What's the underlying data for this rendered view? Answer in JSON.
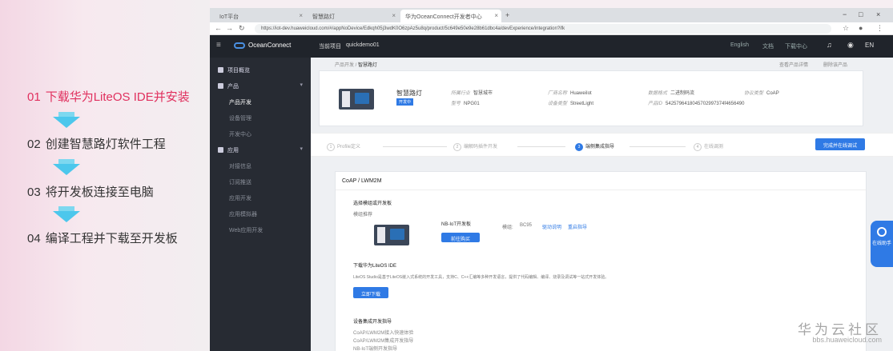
{
  "slide": {
    "steps": [
      {
        "num": "01",
        "text": "下载华为LiteOS IDE并安装",
        "active": true
      },
      {
        "num": "02",
        "text": "创建智慧路灯软件工程",
        "active": false
      },
      {
        "num": "03",
        "text": "将开发板连接至电脑",
        "active": false
      },
      {
        "num": "04",
        "text": "编译工程并下载至开发板",
        "active": false
      }
    ]
  },
  "browser": {
    "tabs": [
      "IoT平台",
      "智慧路灯",
      "华为OceanConnect开发者中心"
    ],
    "new_tab": "+",
    "url": "https://iot-dev.huaweicloud.com/#/appNoDevice/Edkqh05j3wdK0O6zpAz5u8q/product/5c649e50e9e28b61dbc4a/devExperience/integration?ifk",
    "win_controls": [
      "−",
      "□",
      "×"
    ]
  },
  "topnav": {
    "brand": "OceanConnect",
    "project_label": "当前项目",
    "project_value": "quickdemo01",
    "right": [
      "English",
      "文档",
      "下载中心",
      "EN"
    ]
  },
  "sidebar": {
    "items": [
      {
        "label": "项目概览",
        "type": "grp"
      },
      {
        "label": "产品",
        "type": "grp",
        "caret": "▾"
      },
      {
        "label": "产品开发",
        "type": "sub",
        "selected": true
      },
      {
        "label": "设备管理",
        "type": "sub"
      },
      {
        "label": "开发中心",
        "type": "sub"
      },
      {
        "label": "应用",
        "type": "grp",
        "caret": "▾"
      },
      {
        "label": "对接信息",
        "type": "sub"
      },
      {
        "label": "订阅推送",
        "type": "sub"
      },
      {
        "label": "应用开发",
        "type": "sub"
      },
      {
        "label": "应用模拟器",
        "type": "sub"
      },
      {
        "label": "Web应用开发",
        "type": "sub"
      }
    ]
  },
  "content": {
    "breadcrumb": [
      "产品开发",
      "智慧路灯"
    ],
    "top_links": [
      "查看产品详情",
      "删除该产品"
    ],
    "product": {
      "name": "智慧路灯",
      "badge": "开发中",
      "fields": [
        {
          "k": "所属行业",
          "v": "智慧城市"
        },
        {
          "k": "厂商名称",
          "v": "HuaweiIot"
        },
        {
          "k": "设备类型",
          "v": "StreetLight"
        },
        {
          "k": "型号",
          "v": "NPG01"
        },
        {
          "k": "数据格式",
          "v": "二进制码流"
        },
        {
          "k": "协议类型",
          "v": "CoAP"
        },
        {
          "k": "产品ID",
          "v": "5425796418045702997374f4656490"
        }
      ]
    },
    "steps": [
      {
        "n": "1",
        "label": "Profile定义"
      },
      {
        "n": "2",
        "label": "编解码插件开发"
      },
      {
        "n": "3",
        "label": "端侧集成指导"
      },
      {
        "n": "4",
        "label": "在线调测"
      }
    ],
    "next_button": "完成并在线调试",
    "section": {
      "protocol": "CoAP / LWM2M",
      "choose_title": "选择模组或开发板",
      "recommend": "模组推荐",
      "board_name": "NB-IoT开发板",
      "board_button": "前往购买",
      "board_tags": [
        "模组:",
        "BC95",
        "驱动说明",
        "重启指导"
      ],
      "ide_title": "下载华为LiteOS IDE",
      "ide_desc": "LiteOS Studio是基于LiteOS嵌入式系统的开发工具，支持C、C++汇编等多种开发语言，提供了代码编辑、编译、烧录及调试等一站式开发体验。",
      "ide_button": "立即下载",
      "guide_title": "设备集成开发指导",
      "guide_links": [
        "CoAP/LWM2M接入快速体验",
        "CoAP/LWM2M集成开发指导",
        "NB-IoT端侧开发指导"
      ]
    },
    "help": "在线助手"
  },
  "watermark": {
    "cn": "华为云社区",
    "en": "bbs.huaweicloud.com"
  }
}
